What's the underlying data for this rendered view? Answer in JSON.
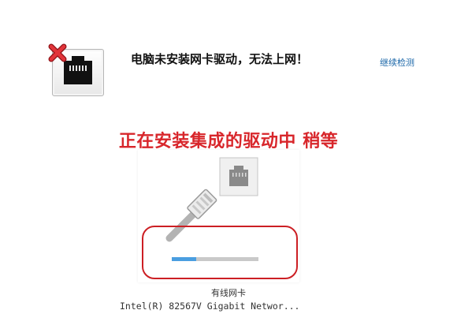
{
  "header": {
    "title": "电脑未安装网卡驱动，无法上网！",
    "link": "继续检测"
  },
  "banner": "正在安装集成的驱动中  稍等",
  "adapter": {
    "name": "有线网卡",
    "description": "Intel(R) 82567V Gigabit Networ..."
  },
  "progress": {
    "fraction": 0.28
  },
  "icons": [
    "network-port-icon",
    "error-x-icon",
    "ethernet-cable-icon"
  ],
  "colors": {
    "banner": "#d8262b",
    "link": "#1a66a8",
    "progress_fill": "#4a9ee0",
    "progress_track": "#c9c9c9",
    "highlight": "#cc1f24"
  }
}
